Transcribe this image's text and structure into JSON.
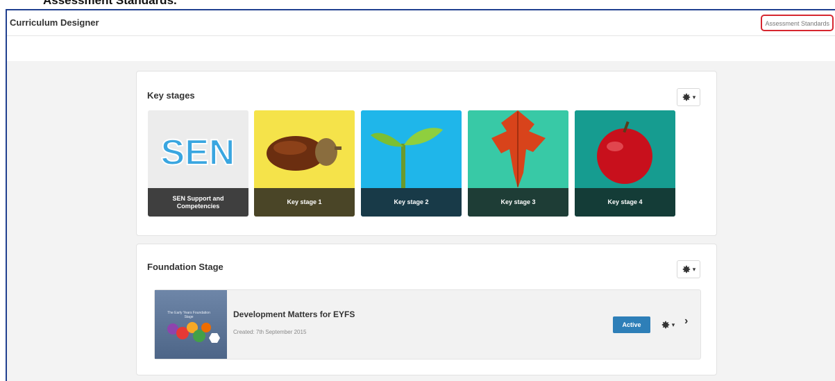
{
  "caption": "Assessment Standards.",
  "header": {
    "app_title": "Curriculum Designer",
    "assessment_link": "Assessment Standards"
  },
  "key_stages": {
    "title": "Key stages",
    "tiles": [
      {
        "label": "SEN Support and Competencies",
        "art_text": "SEN"
      },
      {
        "label": "Key stage 1"
      },
      {
        "label": "Key stage 2"
      },
      {
        "label": "Key stage 3"
      },
      {
        "label": "Key stage 4"
      }
    ]
  },
  "foundation": {
    "title": "Foundation Stage",
    "course": {
      "thumb_text": "The Early Years Foundation Stage",
      "title": "Development Matters for EYFS",
      "created": "Created: 7th September 2015",
      "status": "Active"
    }
  },
  "icons": {
    "settings": "gear-icon",
    "dropdown": "caret-down-icon",
    "open": "chevron-right-icon"
  },
  "colors": {
    "header_outline": "#1f3f8f",
    "highlight": "#d6262f",
    "active_badge": "#2e7fb8"
  }
}
